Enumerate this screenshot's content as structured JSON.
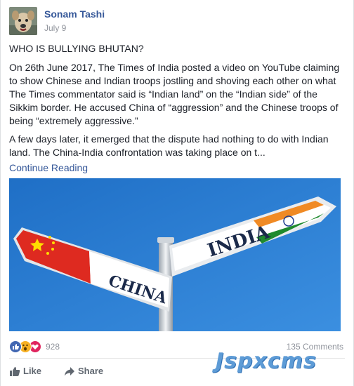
{
  "post": {
    "author": "Sonam Tashi",
    "date": "July 9",
    "headline": "WHO IS BULLYING BHUTAN?",
    "paragraph1": "On 26th June 2017, The Times of India posted a video on YouTube claiming to show Chinese and Indian troops jostling and shoving each other on what The Times commentator said is “Indian land” on the “Indian side” of the Sikkim border. He accused China of “aggression” and the Chinese troops of being “extremely aggressive.”",
    "paragraph2": "A few days later, it emerged that the dispute had nothing to do with Indian land. The China-India confrontation was taking place on t...",
    "continue_label": "Continue Reading",
    "image": {
      "sign_china": "CHINA",
      "sign_india": "INDIA"
    }
  },
  "reactions": {
    "icons": [
      "like-icon",
      "wow-icon",
      "love-icon"
    ],
    "count": "928",
    "comments": "135 Comments"
  },
  "actions": {
    "like_label": "Like",
    "share_label": "Share"
  },
  "watermark": "Jspxcms",
  "colors": {
    "link": "#365899",
    "text": "#1d2129",
    "meta": "#90949c",
    "sky": "#2f7fd3",
    "like": "#4267b2",
    "love": "#e0245e",
    "wow": "#f7b125"
  }
}
